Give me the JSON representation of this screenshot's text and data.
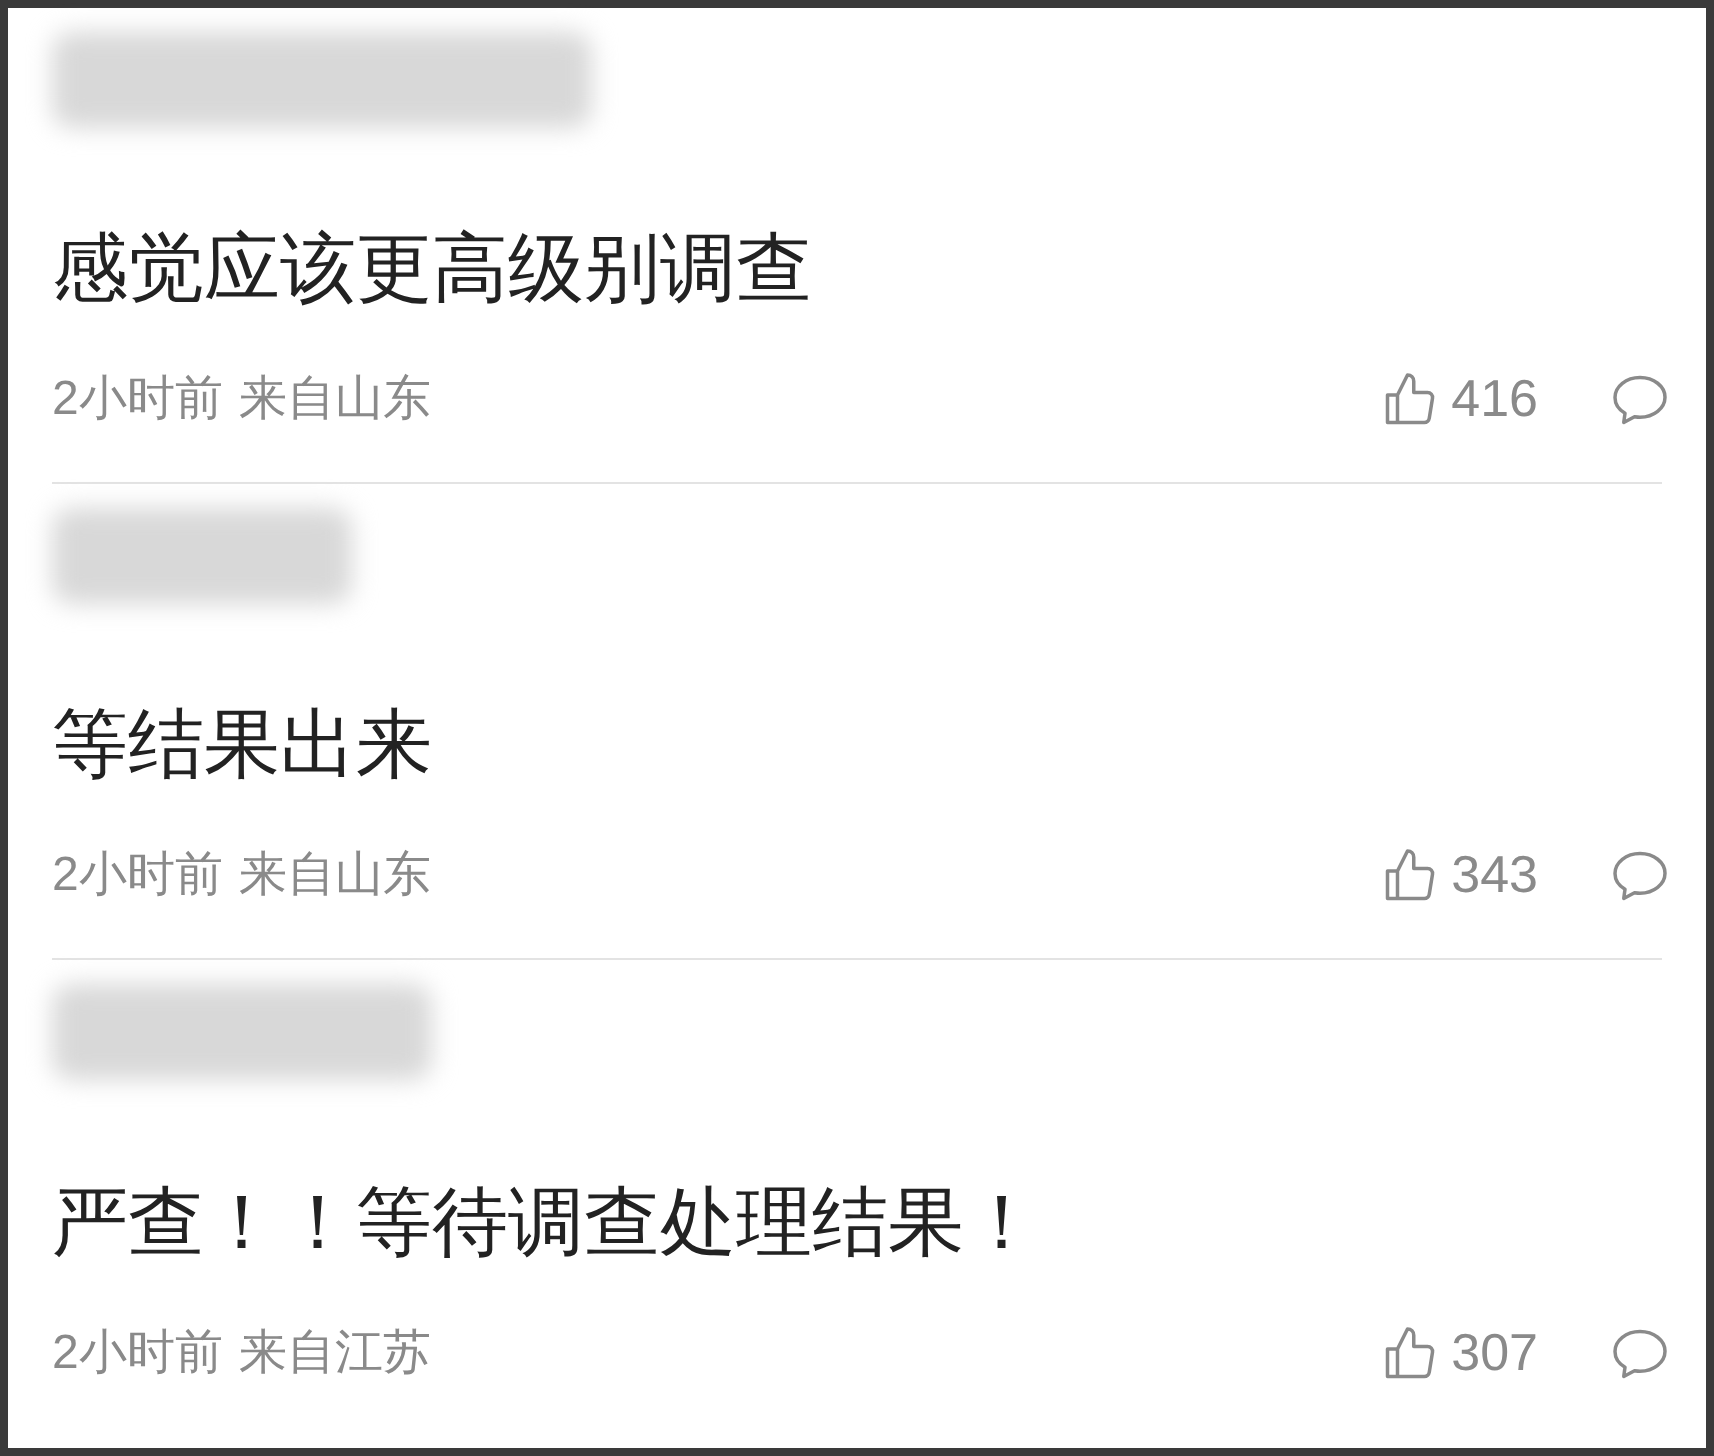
{
  "comments": [
    {
      "text": "感觉应该更高级别调查",
      "time": "2小时前",
      "location": "来自山东",
      "likes": "416"
    },
    {
      "text": "等结果出来",
      "time": "2小时前",
      "location": "来自山东",
      "likes": "343"
    },
    {
      "text": "严查！！等待调查处理结果！",
      "time": "2小时前",
      "location": "来自江苏",
      "likes": "307"
    }
  ]
}
